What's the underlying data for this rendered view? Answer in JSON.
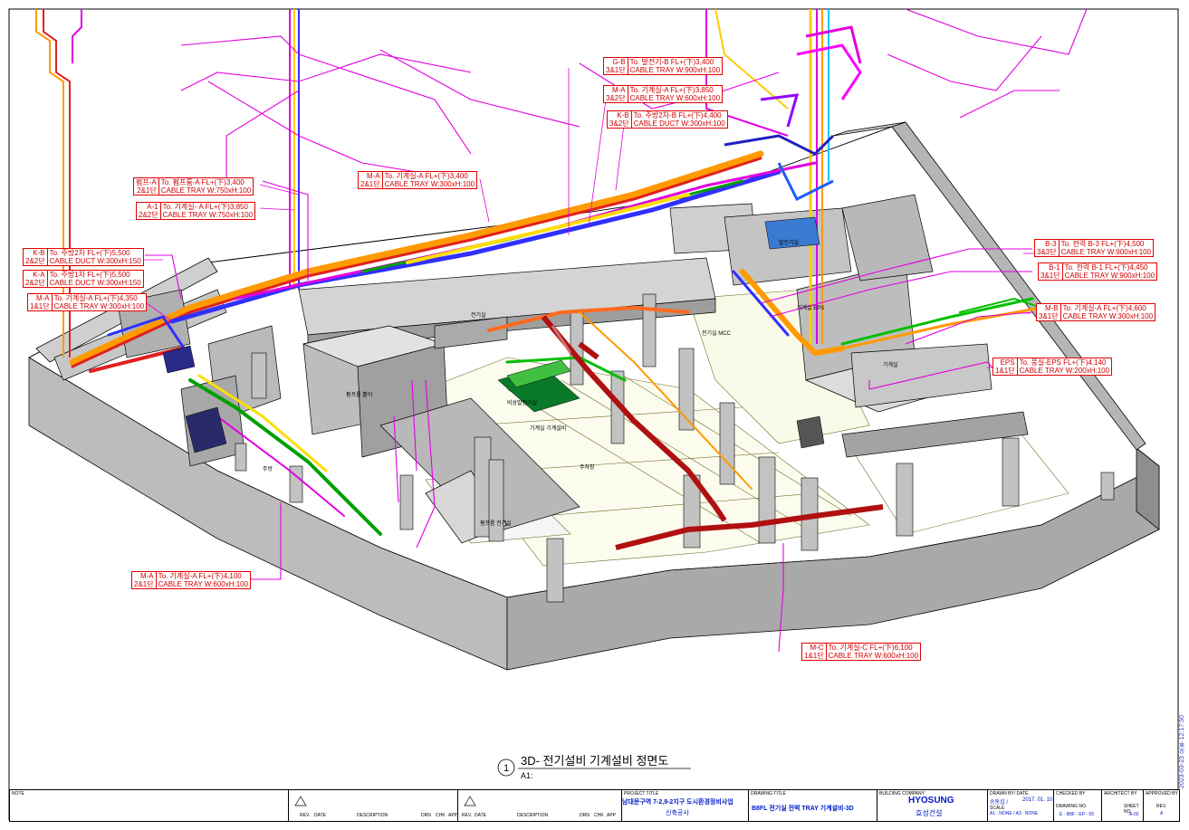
{
  "callouts": [
    {
      "code": [
        "G-B",
        "3&1단"
      ],
      "lines": [
        "To. 발전기-B FL+(下)3,400",
        "CABLE TRAY W:900xH:100"
      ]
    },
    {
      "code": [
        "M-A",
        "3&2단"
      ],
      "lines": [
        "To. 기계실-A FL+(下)3,850",
        "CABLE TRAY W:600xH:100"
      ]
    },
    {
      "code": [
        "K-B",
        "3&2단"
      ],
      "lines": [
        "To. 주방2차-B FL+(下)4,400",
        "CABLE DUCT W:300xH:100"
      ]
    },
    {
      "code": [
        "M-A",
        "2&1단"
      ],
      "lines": [
        "To. 기계실-A FL+(下)3,400",
        "CABLE TRAY W:300xH:100"
      ]
    },
    {
      "code": [
        "펌프-A",
        "2&1단"
      ],
      "lines": [
        "To. 펌프룸-A FL+(下)3,400",
        "CABLE TRAY W:750xH:100"
      ]
    },
    {
      "code": [
        "A-1",
        "2&2단"
      ],
      "lines": [
        "To. 기계실- A FL+(下)3,850",
        "CABLE TRAY W:750xH:100"
      ]
    },
    {
      "code": [
        "K-B",
        "2&2단"
      ],
      "lines": [
        "To. 주방2차 FL+(下)5,500",
        "CABLE DUCT W:300xH:150"
      ]
    },
    {
      "code": [
        "K-A",
        "2&2단"
      ],
      "lines": [
        "To. 주방1차 FL+(下)5,500",
        "CABLE DUCT W:300xH:150"
      ]
    },
    {
      "code": [
        "M-A",
        "1&1단"
      ],
      "lines": [
        "To. 기계실-A FL+(下)4,350",
        "CABLE TRAY W:300xH:100"
      ]
    },
    {
      "code": [
        "B-3",
        "3&3단"
      ],
      "lines": [
        "To. 전력 B-3 FL+(下)4,500",
        "CABLE TRAY W:900xH:100"
      ]
    },
    {
      "code": [
        "B-1",
        "3&1단"
      ],
      "lines": [
        "To. 전력 B-1 FL+(下)4,450",
        "CABLE TRAY W:900xH:100"
      ]
    },
    {
      "code": [
        "M-B",
        "3&1단"
      ],
      "lines": [
        "To. 기계실-A FL+(下)4,600",
        "CABLE TRAY W:300xH:100"
      ]
    },
    {
      "code": [
        "EPS",
        "1&1단"
      ],
      "lines": [
        "To. 풍실-EPS FL+(下)4,140",
        "CABLE TRAY W:200xH:100"
      ]
    },
    {
      "code": [
        "M-A",
        "2&1단"
      ],
      "lines": [
        "To. 기계실-A FL+(下)4,100",
        "CABLE TRAY W:600xH:100"
      ]
    },
    {
      "code": [
        "M-C",
        "1&1단"
      ],
      "lines": [
        "To. 기계실-C FL+(下)6,100",
        "CABLE TRAY W:600xH:100"
      ]
    }
  ],
  "room_labels": [
    "펌프룸 홀이",
    "발전기실",
    "전기실",
    "기계실",
    "주차장",
    "주방",
    "기계실 EPS",
    "펌프룸 전기실",
    "비상발전기실",
    "전기실 MCC",
    "기계실 기계설비"
  ],
  "view_title": {
    "number": "1",
    "title": "3D- 전기설비 기계설비 정면도",
    "scale": "A1:"
  },
  "title_block": {
    "note": "NOTE",
    "rev_headers": [
      "REV.",
      "DATE",
      "DESCRIPTION",
      "DRN",
      "CHK",
      "APP"
    ],
    "project_title_label": "PROJECT TITLE",
    "project_title": [
      "남대문구역 7-2,9-2지구 도시환경정비사업",
      "신축공사"
    ],
    "drawing_title_label": "DRAWING TITLE",
    "drawing_title": "B8FL 전기실 전력 TRAY 기계설비-3D",
    "company_label": "BUILDING COMPANY",
    "company_name": "HYOSUNG",
    "company_sub": "효성건설",
    "drawn_label": "DRAWN BY/ DATE",
    "drawn_by": "송동섭 /",
    "drawn_date": "2017. 01. 10",
    "checked_label": "CHECKED BY",
    "architect_label": "ARCHITECT BY",
    "approved_label": "APPROVED BY",
    "scale_label": "SCALE",
    "scale_value": "A1 : NONE / A3 : NONE",
    "drawing_no_label": "DRAWING NO.",
    "drawing_no": "E - B8F - EP - 05",
    "sheet_label": "SHEET NO.",
    "sheet_no": "A-02",
    "rev_label": "REV.",
    "rev_value": "A"
  },
  "print_stamp": "2023-03-23 오후 12:17:50"
}
